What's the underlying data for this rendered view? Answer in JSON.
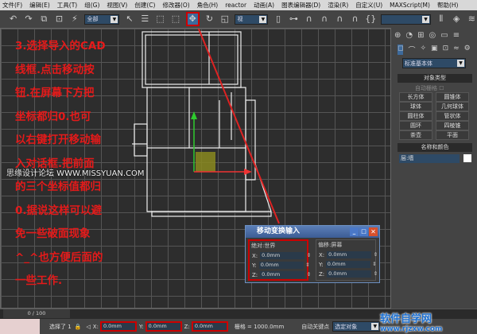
{
  "menu": [
    "文件(F)",
    "编辑(E)",
    "工具(T)",
    "组(G)",
    "视图(V)",
    "创建(C)",
    "修改器(O)",
    "角色(H)",
    "reactor",
    "动画(A)",
    "图表编辑器(D)",
    "渲染(R)",
    "自定义(U)",
    "MAXScript(M)",
    "帮助(H)"
  ],
  "toolbar": {
    "selection_filter": "全部",
    "view_select": "视",
    "named_selection": ""
  },
  "annotation": [
    "3.选择导入的CAD",
    "线框.点击移动按",
    "钮.在屏幕下方把",
    "坐标都归0.也可",
    "以右键打开移动输",
    "入对话框.把前面",
    "的三个坐标值都归",
    "0.据说这样可以避",
    "免一些破面现象",
    "^_^也方便后面的",
    "一些工作."
  ],
  "watermark": "思缘设计论坛 WWW.MISSYUAN.COM",
  "command_panel": {
    "dropdown": "标准基本体",
    "object_type_title": "对象类型",
    "autogrid": "自动栅格",
    "buttons": [
      "长方体",
      "圆锥体",
      "球体",
      "几何球体",
      "圆柱体",
      "管状体",
      "圆环",
      "四棱锥",
      "茶壶",
      "平面"
    ],
    "name_color_title": "名称和颜色",
    "name_value": "层:墙"
  },
  "dialog": {
    "title": "移动变换输入",
    "absolute_label": "绝对:世界",
    "offset_label": "偏移:屏幕",
    "absolute": [
      {
        "axis": "X:",
        "value": "0.0mm"
      },
      {
        "axis": "Y:",
        "value": "0.0mm"
      },
      {
        "axis": "Z:",
        "value": "0.0mm"
      }
    ],
    "offset": [
      {
        "axis": "X:",
        "value": "0.0mm"
      },
      {
        "axis": "Y:",
        "value": "0.0mm"
      },
      {
        "axis": "Z:",
        "value": "0.0mm"
      }
    ]
  },
  "timeline": {
    "frame": "0 / 100"
  },
  "status": {
    "selected": "选择了 1",
    "x_label": "X:",
    "x": "0.0mm",
    "y_label": "Y:",
    "y": "0.0mm",
    "z_label": "Z:",
    "z": "0.0mm",
    "grid": "栅格 = 1000.0mm",
    "auto_key": "自动关键点",
    "key_filter": "选定对象"
  },
  "logo": {
    "name": "软件自学网",
    "url": "www.rjzxw.com"
  },
  "colors": {
    "annotation": "#e51a1a",
    "highlight": "#cc0000"
  }
}
